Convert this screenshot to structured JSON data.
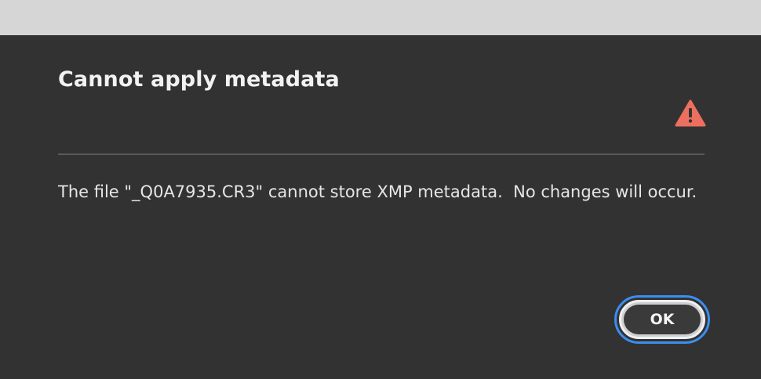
{
  "dialog": {
    "title": "Cannot apply metadata",
    "message": "The file \"_Q0A7935.CR3\" cannot store XMP metadata.  No changes will occur.",
    "ok_label": "OK",
    "icon": "warning-triangle-icon"
  },
  "colors": {
    "background": "#323232",
    "warning": "#ec6f5f",
    "focus_ring": "#3b8ef0",
    "text": "#f2f2f2"
  }
}
